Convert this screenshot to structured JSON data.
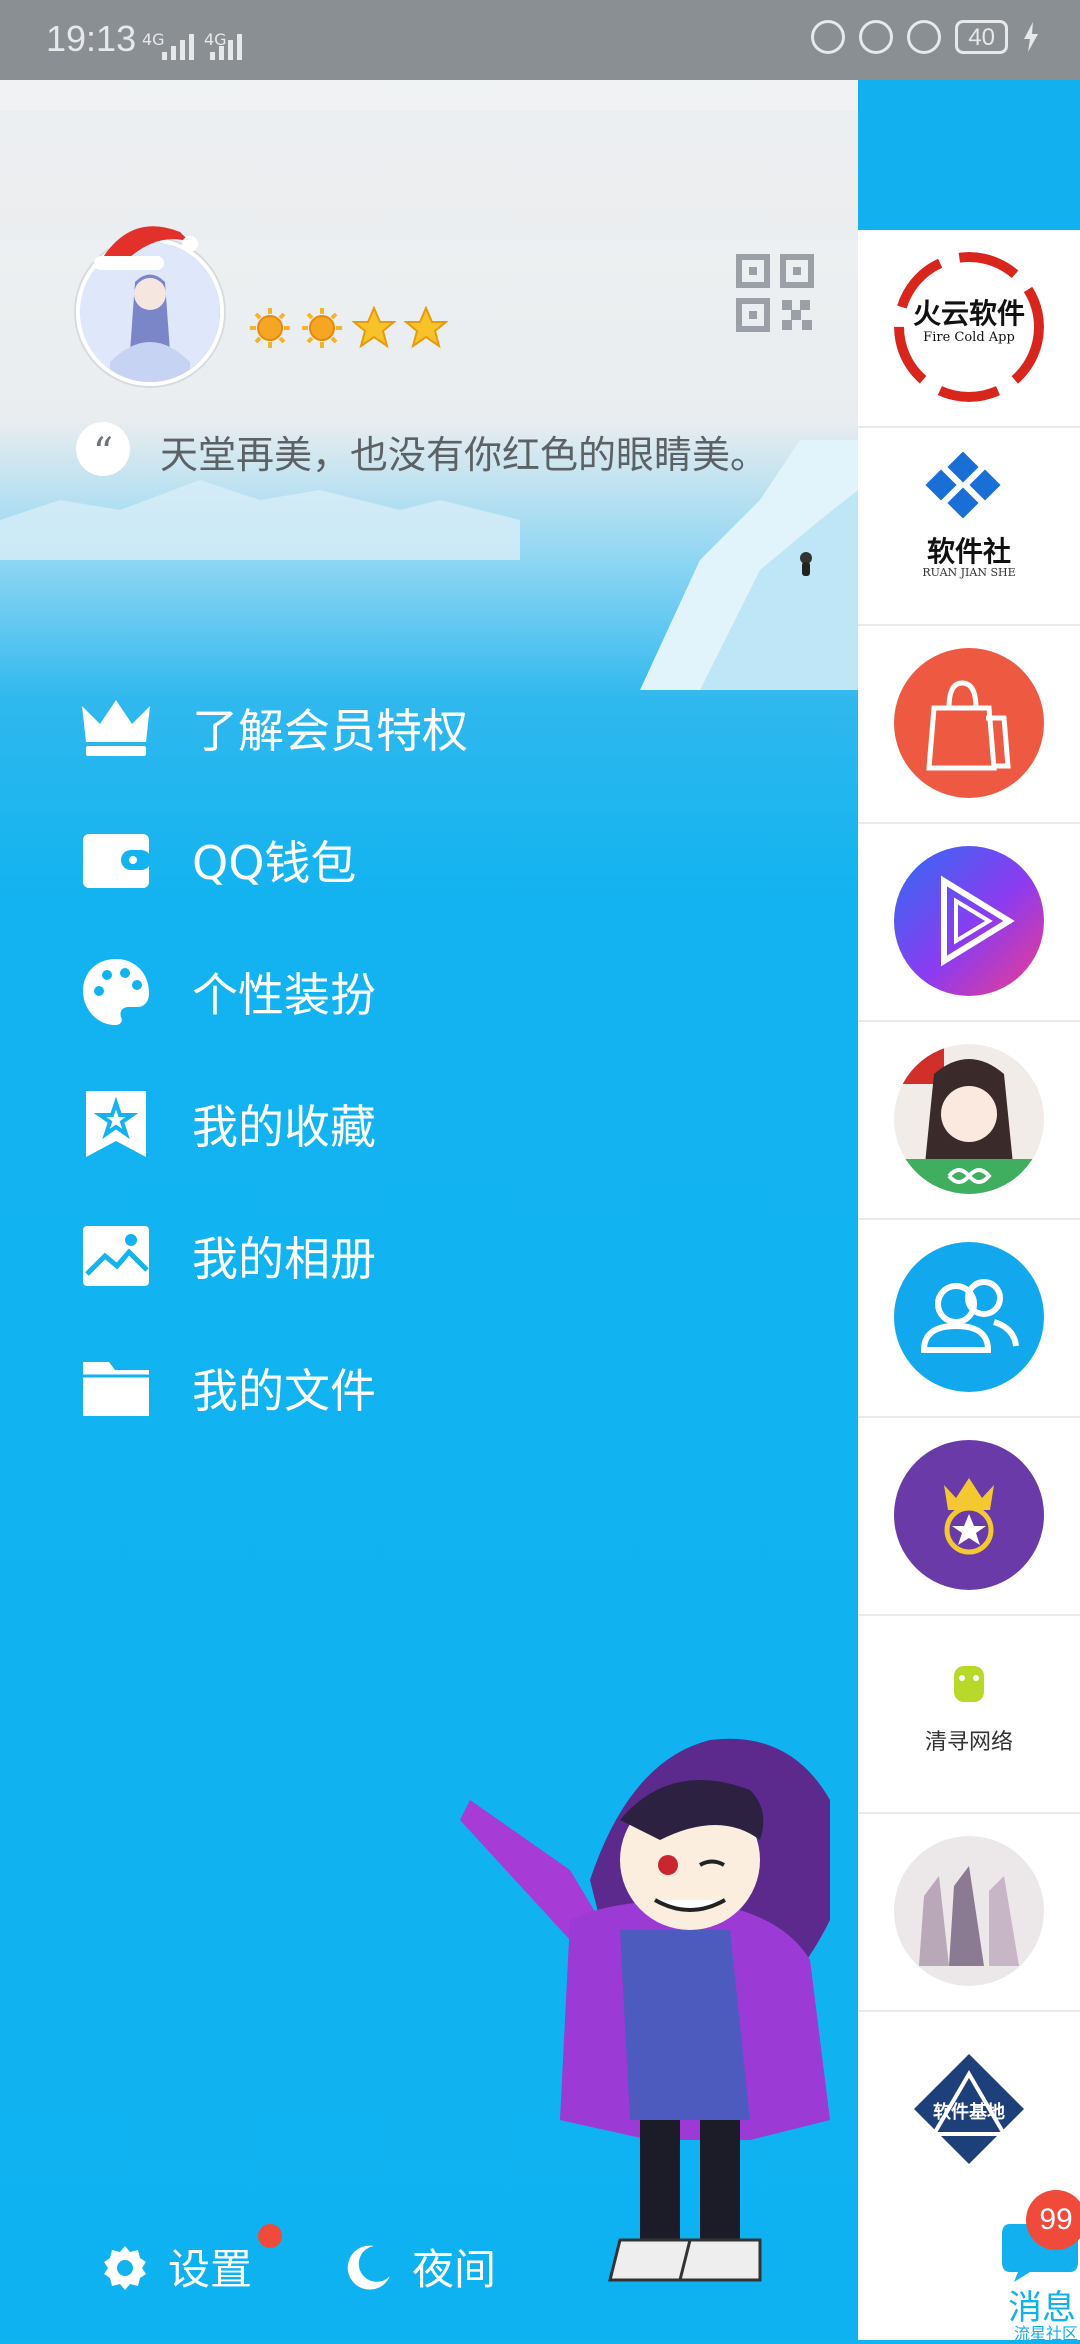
{
  "status_bar": {
    "time": "19:13",
    "signal1": "4G",
    "signal2": "4G",
    "battery": "40"
  },
  "profile": {
    "signature": "天堂再美，也没有你红色的眼睛美。",
    "level_icons": [
      "sun-level-icon",
      "sun-level-icon",
      "star-level-icon",
      "star-level-icon"
    ]
  },
  "menu": [
    {
      "label": "了解会员特权",
      "icon": "crown-icon"
    },
    {
      "label": "QQ钱包",
      "icon": "wallet-icon"
    },
    {
      "label": "个性装扮",
      "icon": "palette-icon"
    },
    {
      "label": "我的收藏",
      "icon": "bookmark-star-icon"
    },
    {
      "label": "我的相册",
      "icon": "photo-icon"
    },
    {
      "label": "我的文件",
      "icon": "folder-icon"
    }
  ],
  "bottom": {
    "settings_label": "设置",
    "night_label": "夜间"
  },
  "right_panel": {
    "items": [
      {
        "name": "火云软件",
        "sub": "Fire Cold App"
      },
      {
        "name": "软件社",
        "sub": "RUAN JIAN SHE"
      },
      {
        "name": "shopping-bag"
      },
      {
        "name": "video-play"
      },
      {
        "name": "anime-girl"
      },
      {
        "name": "contacts"
      },
      {
        "name": "crown-star"
      },
      {
        "name": "清寻网络"
      },
      {
        "name": "group-photo"
      },
      {
        "name": "软件基地"
      }
    ],
    "messages_label": "消息",
    "messages_badge": "99",
    "messages_sub": "流星社区"
  },
  "colors": {
    "accent": "#12b0ee",
    "badge": "#ef4a3a"
  }
}
